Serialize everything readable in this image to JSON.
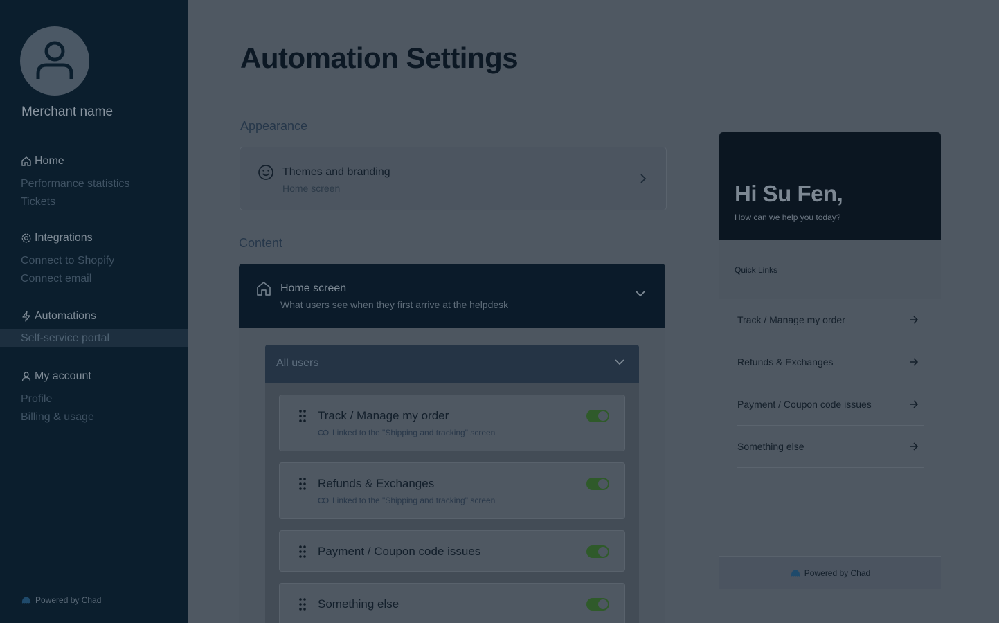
{
  "sidebar": {
    "merchant_name": "Merchant name",
    "sections": [
      {
        "label": "Home",
        "icon": "home-icon",
        "items": [
          "Performance statistics",
          "Tickets"
        ]
      },
      {
        "label": "Integrations",
        "icon": "gear-icon",
        "items": [
          "Connect to Shopify",
          "Connect email"
        ]
      },
      {
        "label": "Automations",
        "icon": "bolt-icon",
        "items": [
          "Self-service portal"
        ]
      },
      {
        "label": "My account",
        "icon": "user-icon",
        "items": [
          "Profile",
          "Billing & usage"
        ]
      }
    ],
    "active_item": "Self-service portal",
    "footer": "Powered by Chad"
  },
  "main": {
    "title": "Automation Settings",
    "appearance_label": "Appearance",
    "theme_card": {
      "title": "Themes and branding",
      "subtitle": "Home screen"
    },
    "content_label": "Content",
    "home_screen": {
      "title": "Home screen",
      "subtitle": "What users see when they first arrive at the helpdesk"
    },
    "audience_select": "All users",
    "quick_links": [
      {
        "title": "Track / Manage my order",
        "linked": "Linked to the \"Shipping and tracking\" screen",
        "enabled": true
      },
      {
        "title": "Refunds & Exchanges",
        "linked": "Linked to the \"Shipping and tracking\" screen",
        "enabled": true
      },
      {
        "title": "Payment / Coupon code issues",
        "linked": "",
        "enabled": true
      },
      {
        "title": "Something else",
        "linked": "",
        "enabled": true
      }
    ]
  },
  "preview": {
    "greeting": "Hi Su Fen,",
    "subtitle": "How can we help you today?",
    "quick_links_label": "Quick Links",
    "links": [
      "Track / Manage my order",
      "Refunds & Exchanges",
      "Payment / Coupon code issues",
      "Something else"
    ],
    "footer": "Powered by Chad"
  },
  "colors": {
    "sidebar_bg": "#0b1e2d",
    "overlay_bg": "#4f5862",
    "toggle_on": "#2f5a2a"
  }
}
